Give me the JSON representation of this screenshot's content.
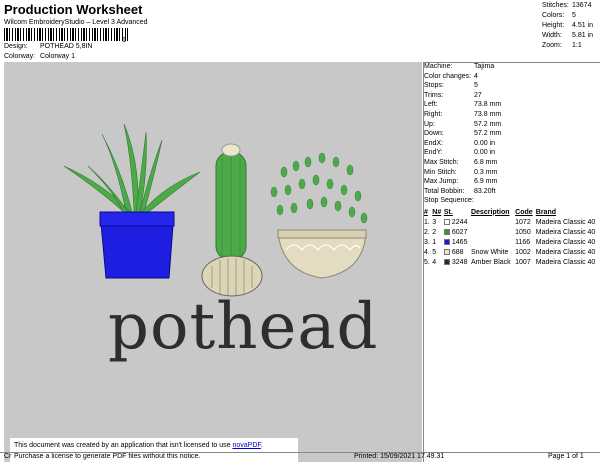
{
  "header": {
    "title": "Production Worksheet",
    "subtitle": "Wilcom EmbroideryStudio – Level 3 Advanced",
    "barcode_num": "1",
    "design_label": "Design:",
    "design_value": "POTHEAD 5,8IN",
    "colorway_label": "Colorway:",
    "colorway_value": "Colorway 1"
  },
  "top_stats": [
    {
      "label": "Stitches:",
      "value": "13674"
    },
    {
      "label": "Colors:",
      "value": "5"
    },
    {
      "label": "Height:",
      "value": "4.51 in"
    },
    {
      "label": "Width:",
      "value": "5.81 in"
    },
    {
      "label": "Zoom:",
      "value": "1:1"
    }
  ],
  "machine_info": [
    {
      "label": "Machine:",
      "value": "Tajima"
    },
    {
      "label": "Color changes:",
      "value": "4"
    },
    {
      "label": "Stops:",
      "value": "5"
    },
    {
      "label": "Trims:",
      "value": "27"
    },
    {
      "label": "Left:",
      "value": "73.8 mm"
    },
    {
      "label": "Right:",
      "value": "73.8 mm"
    },
    {
      "label": "Up:",
      "value": "57.2 mm"
    },
    {
      "label": "Down:",
      "value": "57.2 mm"
    },
    {
      "label": "EndX:",
      "value": "0.00 in"
    },
    {
      "label": "EndY:",
      "value": "0.00 in"
    },
    {
      "label": "Max Stitch:",
      "value": "6.8 mm"
    },
    {
      "label": "Min Stitch:",
      "value": "0.3 mm"
    },
    {
      "label": "Max Jump:",
      "value": "6.9 mm"
    },
    {
      "label": "Total Bobbin:",
      "value": "83.20ft"
    }
  ],
  "stop_sequence": {
    "heading": "Stop Sequence:",
    "columns": [
      "#",
      "N#",
      "St.",
      "Description",
      "Code",
      "Brand"
    ],
    "rows": [
      {
        "num": "1.",
        "n": "3",
        "color": "#ffffff",
        "st": "2244",
        "desc": "",
        "code": "1072",
        "brand": "Madeira Classic 40"
      },
      {
        "num": "2.",
        "n": "2",
        "color": "#3a9a3a",
        "st": "6027",
        "desc": "",
        "code": "1050",
        "brand": "Madeira Classic 40"
      },
      {
        "num": "3.",
        "n": "1",
        "color": "#1a1acc",
        "st": "1465",
        "desc": "",
        "code": "1166",
        "brand": "Madeira Classic 40"
      },
      {
        "num": "4.",
        "n": "5",
        "color": "#ece6cc",
        "st": "688",
        "desc": "Snow White",
        "code": "1002",
        "brand": "Madeira Classic 40"
      },
      {
        "num": "5.",
        "n": "4",
        "color": "#2a2a2a",
        "st": "3248",
        "desc": "Amber Black",
        "code": "1007",
        "brand": "Madeira Classic 40"
      }
    ]
  },
  "design_text": "pothead",
  "notice": {
    "line1_prefix": "This document was created by an application that isn't licensed to use ",
    "link": "novaPDF",
    "line1_suffix": ".",
    "line2": "Purchase a license to generate PDF files without this notice."
  },
  "footer": {
    "left": "Cr",
    "printed": "Printed: 15/09/2021 17.49.31",
    "page": "Page 1 of 1"
  }
}
